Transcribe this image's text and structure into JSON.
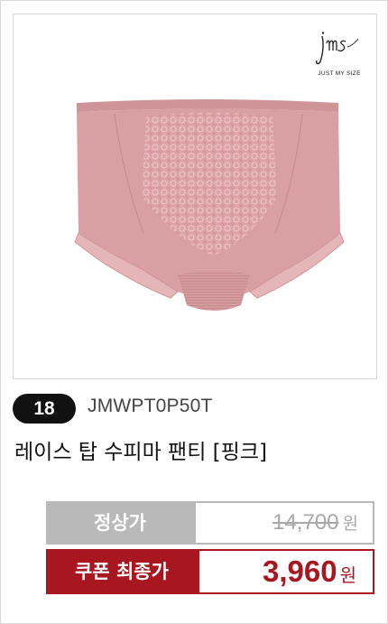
{
  "brand": {
    "logo_script": "jms",
    "tagline": "JUST MY SIZE"
  },
  "product": {
    "rank": "18",
    "code": "JMWPT0P50T",
    "name": "레이스 탑 수피마 팬티 [핑크]"
  },
  "price": {
    "regular_label": "정상가",
    "regular_value": "14,700",
    "regular_unit": "원",
    "final_label": "쿠폰 최종가",
    "final_value": "3,960",
    "final_unit": "원"
  },
  "colors": {
    "accent": "#a81620",
    "muted": "#b9b9b9",
    "product": "#d9a0a3"
  }
}
